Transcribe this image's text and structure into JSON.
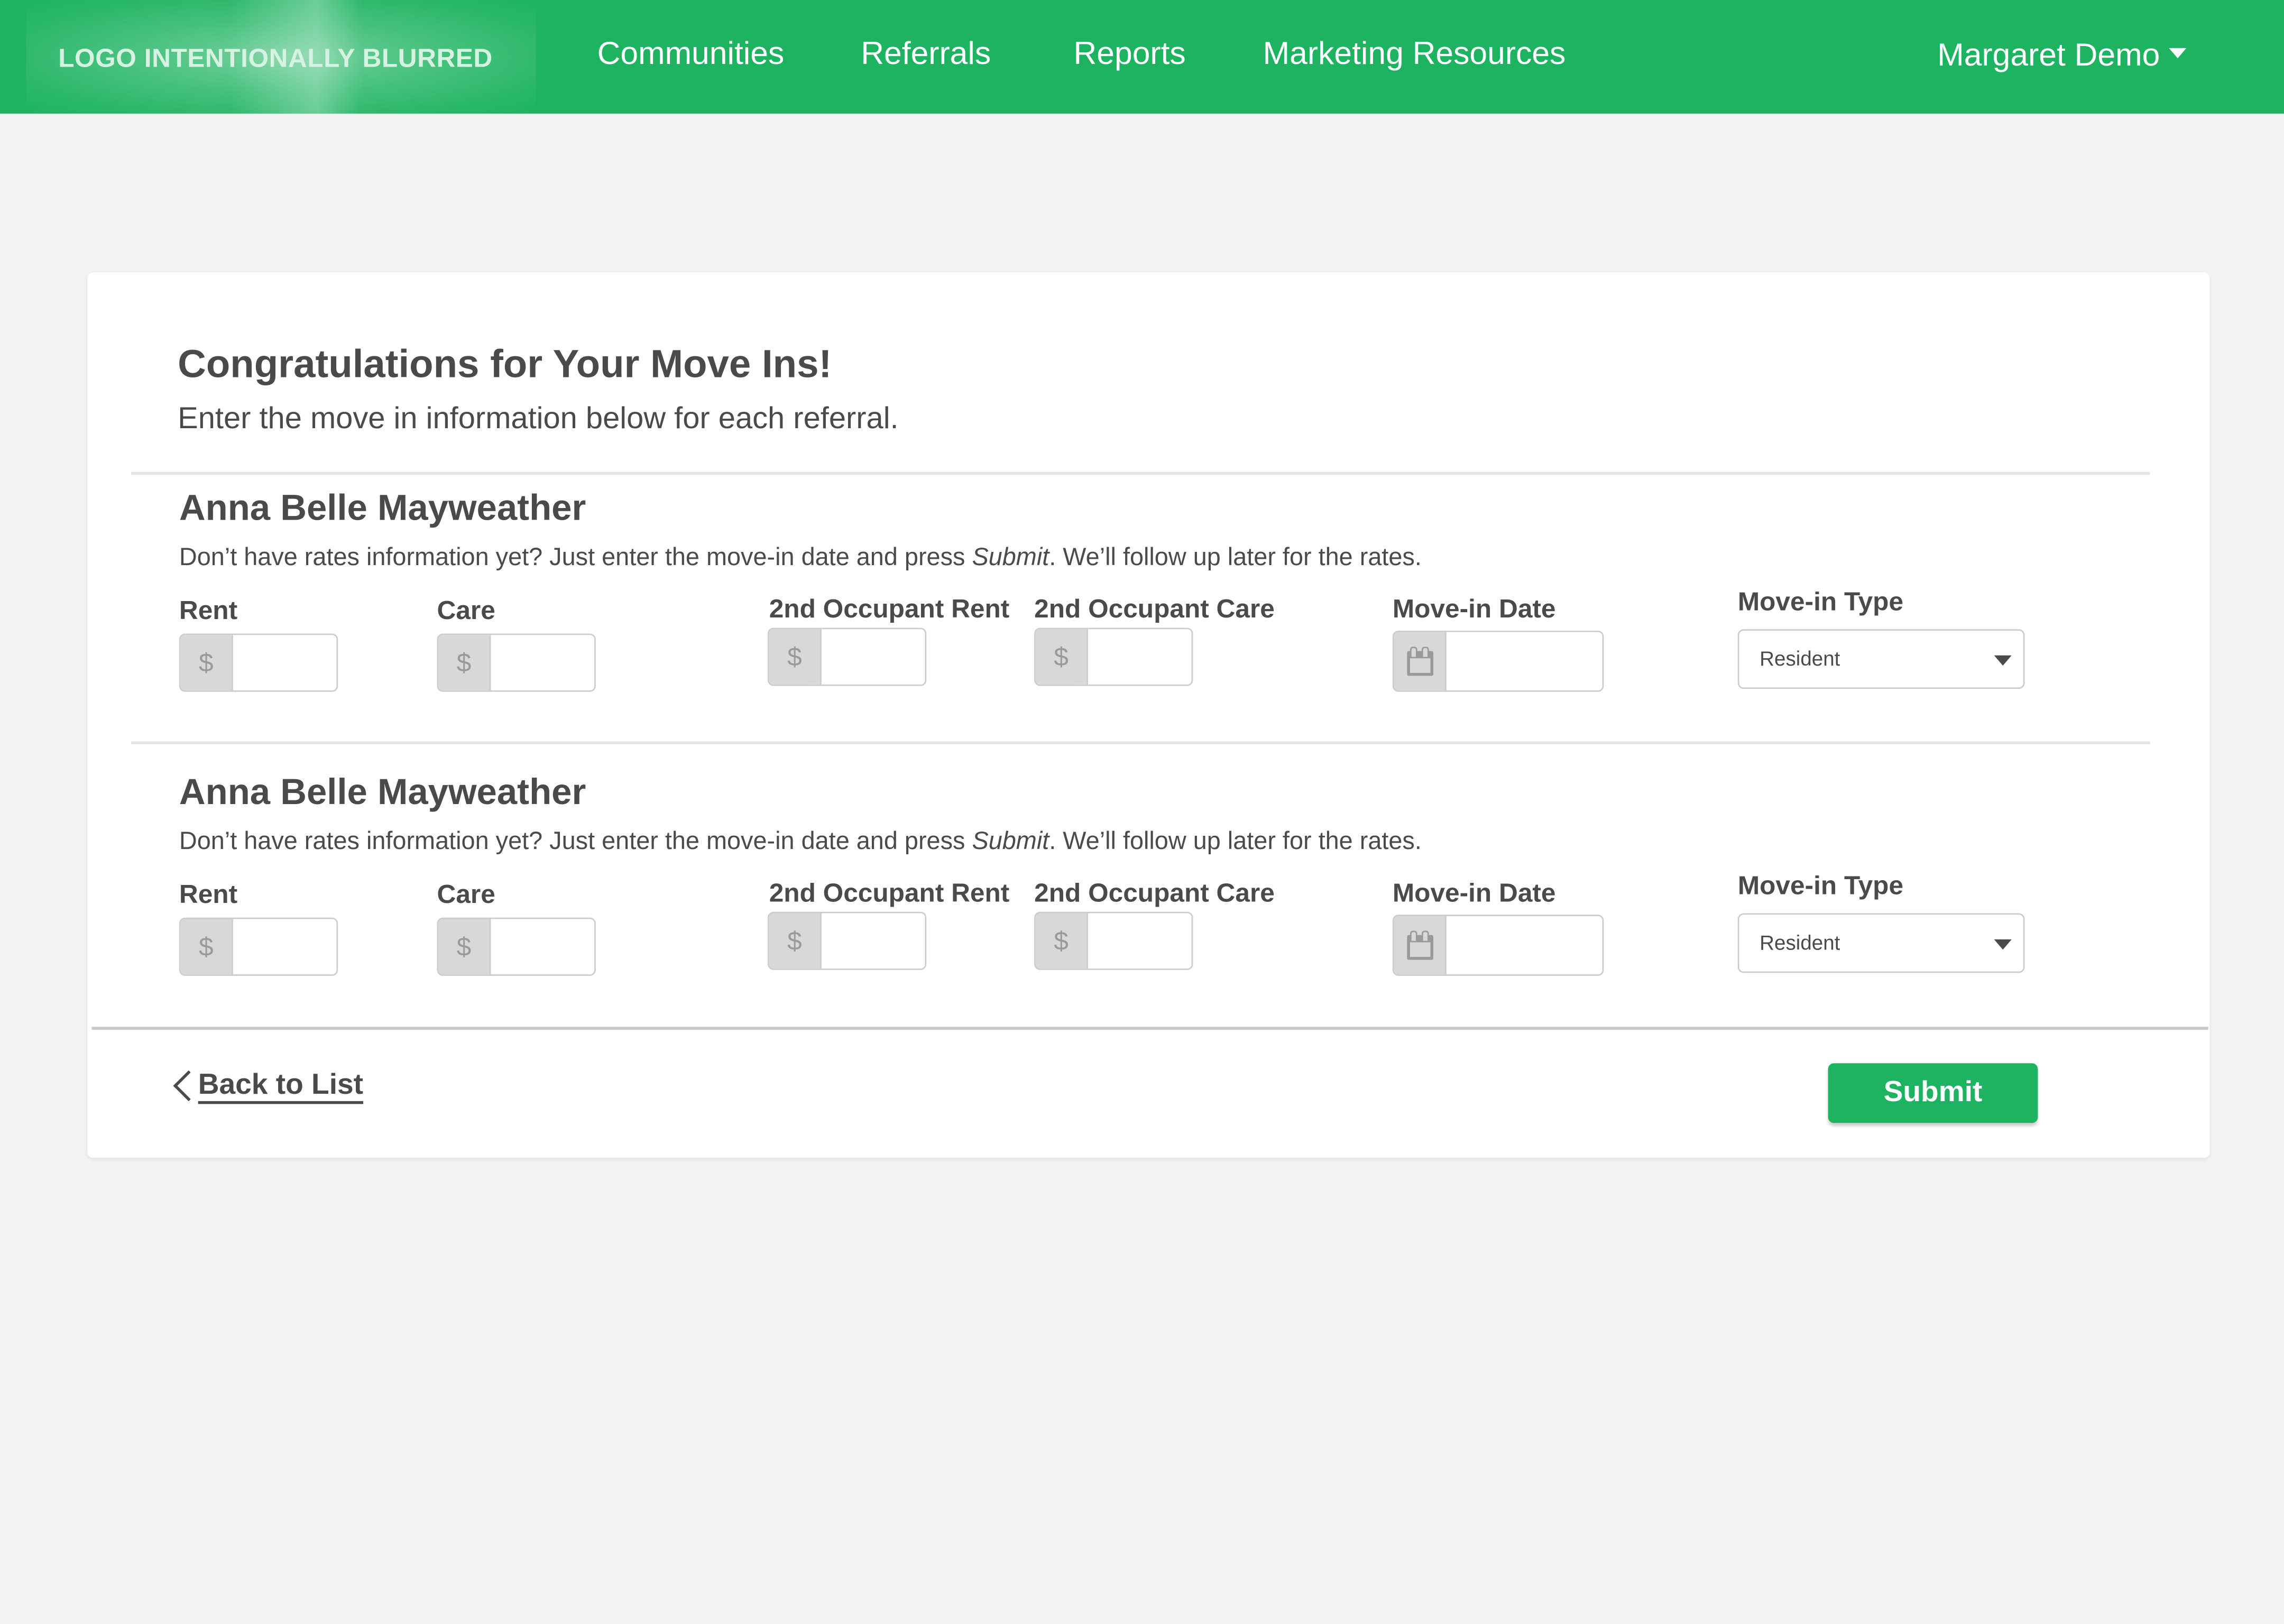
{
  "nav": {
    "logo_text": "LOGO INTENTIONALLY BLURRED",
    "items": [
      {
        "label": "Communities"
      },
      {
        "label": "Referrals"
      },
      {
        "label": "Reports"
      },
      {
        "label": "Marketing Resources"
      }
    ],
    "user_name": "Margaret Demo",
    "brand_color": "#1db360"
  },
  "page": {
    "title": "Congratulations for Your Move Ins!",
    "subtitle": "Enter the move in information below for each referral."
  },
  "referrals": [
    {
      "name": "Anna Belle Mayweather",
      "note_before": "Don’t have rates information yet? Just enter the move-in date and press ",
      "note_emphasis": "Submit",
      "note_after": ". We’ll follow up later for the rates.",
      "fields": {
        "rent": {
          "label": "Rent",
          "prefix": "$",
          "value": ""
        },
        "care": {
          "label": "Care",
          "prefix": "$",
          "value": ""
        },
        "second_rent": {
          "label": "2nd Occupant Rent",
          "prefix": "$",
          "value": ""
        },
        "second_care": {
          "label": "2nd Occupant Care",
          "prefix": "$",
          "value": ""
        },
        "move_in_date": {
          "label": "Move-in Date",
          "icon": "calendar-icon",
          "value": ""
        },
        "move_in_type": {
          "label": "Move-in Type",
          "selected": "Resident"
        }
      }
    },
    {
      "name": "Anna Belle Mayweather",
      "note_before": "Don’t have rates information yet? Just enter the move-in date and press ",
      "note_emphasis": "Submit",
      "note_after": ". We’ll follow up later for the rates.",
      "fields": {
        "rent": {
          "label": "Rent",
          "prefix": "$",
          "value": ""
        },
        "care": {
          "label": "Care",
          "prefix": "$",
          "value": ""
        },
        "second_rent": {
          "label": "2nd Occupant Rent",
          "prefix": "$",
          "value": ""
        },
        "second_care": {
          "label": "2nd Occupant Care",
          "prefix": "$",
          "value": ""
        },
        "move_in_date": {
          "label": "Move-in Date",
          "icon": "calendar-icon",
          "value": ""
        },
        "move_in_type": {
          "label": "Move-in Type",
          "selected": "Resident"
        }
      }
    }
  ],
  "footer": {
    "back_label": "Back to List",
    "submit_label": "Submit"
  }
}
